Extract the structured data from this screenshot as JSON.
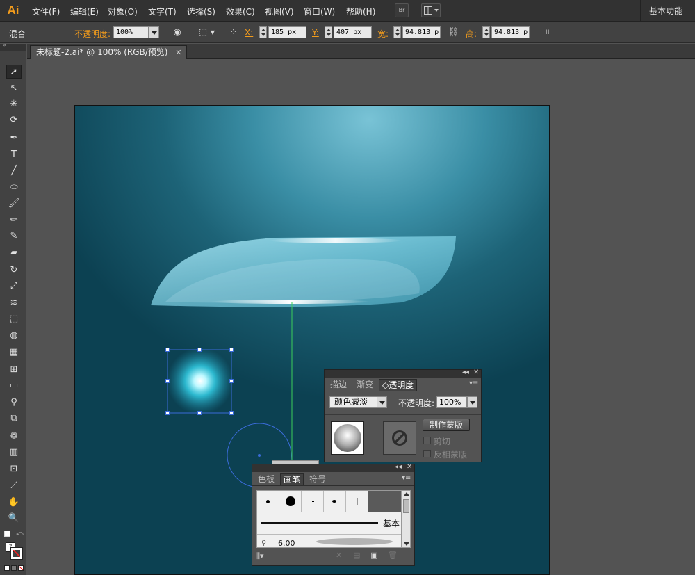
{
  "menubar": {
    "logo": "Ai",
    "items": [
      "文件(F)",
      "编辑(E)",
      "对象(O)",
      "文字(T)",
      "选择(S)",
      "效果(C)",
      "视图(V)",
      "窗口(W)",
      "帮助(H)"
    ],
    "bridge_label": "Br",
    "workspace": "基本功能"
  },
  "controlbar": {
    "mode_label": "混合",
    "opacity_label": "不透明度:",
    "opacity_value": "100%",
    "x_label": "X:",
    "x_value": "185 px",
    "y_label": "Y:",
    "y_value": "407 px",
    "w_label": "宽:",
    "w_value": "94.813 p:",
    "h_label": "高:",
    "h_value": "94.813 p:"
  },
  "document": {
    "tab_title": "未标题-2.ai* @ 100% (RGB/预览)",
    "tab_close": "✕"
  },
  "tools": [
    {
      "name": "selection-tool",
      "glyph": "➚"
    },
    {
      "name": "direct-selection-tool",
      "glyph": "↖"
    },
    {
      "name": "magic-wand-tool",
      "glyph": "✳"
    },
    {
      "name": "lasso-tool",
      "glyph": "⟳"
    },
    {
      "name": "pen-tool",
      "glyph": "✒"
    },
    {
      "name": "type-tool",
      "glyph": "T"
    },
    {
      "name": "line-tool",
      "glyph": "╱"
    },
    {
      "name": "ellipse-tool",
      "glyph": "⬭"
    },
    {
      "name": "paintbrush-tool",
      "glyph": "🖌"
    },
    {
      "name": "pencil-tool",
      "glyph": "✏"
    },
    {
      "name": "blob-brush-tool",
      "glyph": "✎"
    },
    {
      "name": "eraser-tool",
      "glyph": "▰"
    },
    {
      "name": "rotate-tool",
      "glyph": "↻"
    },
    {
      "name": "scale-tool",
      "glyph": "⤢"
    },
    {
      "name": "warp-tool",
      "glyph": "≋"
    },
    {
      "name": "free-transform-tool",
      "glyph": "⬚"
    },
    {
      "name": "shape-builder-tool",
      "glyph": "◍"
    },
    {
      "name": "perspective-grid-tool",
      "glyph": "▦"
    },
    {
      "name": "mesh-tool",
      "glyph": "⊞"
    },
    {
      "name": "gradient-tool",
      "glyph": "▭"
    },
    {
      "name": "eyedropper-tool",
      "glyph": "⚲"
    },
    {
      "name": "blend-tool",
      "glyph": "⧉"
    },
    {
      "name": "symbol-sprayer-tool",
      "glyph": "❁"
    },
    {
      "name": "column-graph-tool",
      "glyph": "▥"
    },
    {
      "name": "artboard-tool",
      "glyph": "⊡"
    },
    {
      "name": "slice-tool",
      "glyph": "⟋"
    },
    {
      "name": "hand-tool",
      "glyph": "✋"
    },
    {
      "name": "zoom-tool",
      "glyph": "🔍"
    }
  ],
  "transparency_panel": {
    "tabs": [
      "描边",
      "渐变",
      "◇透明度"
    ],
    "blend_mode": "颜色减淡",
    "opacity_label": "不透明度:",
    "opacity_value": "100%",
    "make_mask": "制作蒙版",
    "clip_label": "剪切",
    "invert_label": "反相蒙版"
  },
  "brushes_panel": {
    "tabs": [
      "色板",
      "画笔",
      "符号"
    ],
    "basic_label": "基本",
    "size_label": "6.00"
  },
  "colors": {
    "accent": "#f39c1c",
    "selection": "#3a6bd8",
    "guide": "#3ccf5a"
  }
}
